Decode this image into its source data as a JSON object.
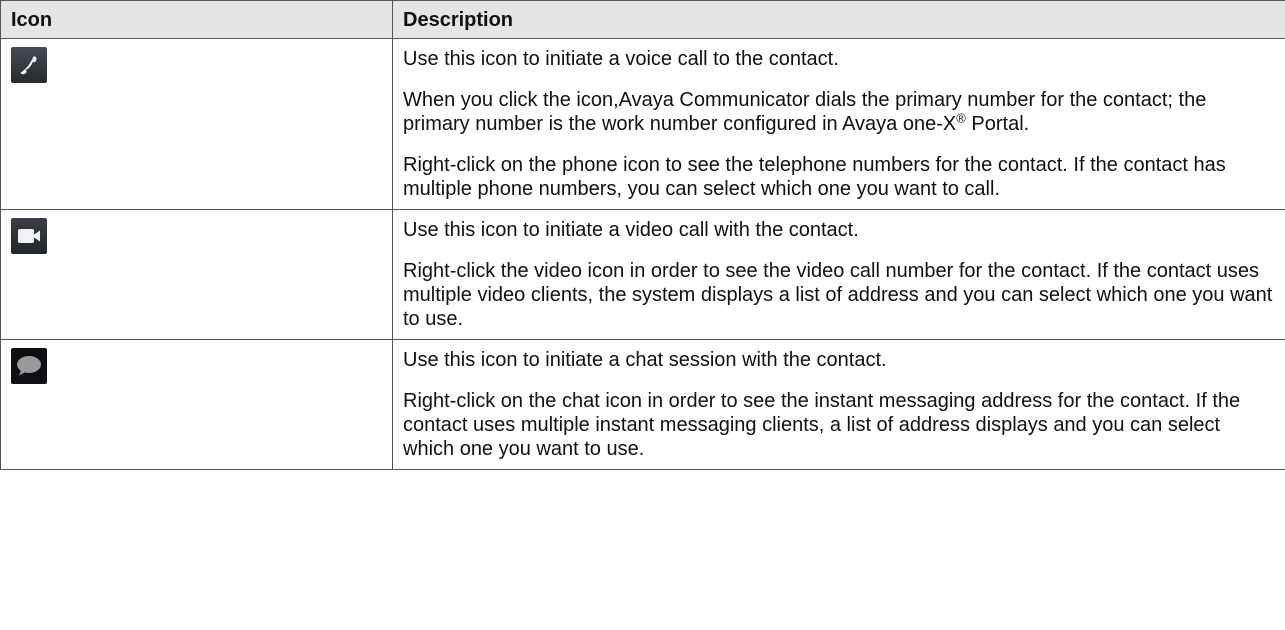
{
  "table": {
    "headers": {
      "icon": "Icon",
      "description": "Description"
    },
    "rows": [
      {
        "icon": "phone-icon",
        "paragraphs": [
          "Use this icon to initiate a voice call to the contact.",
          "When you click the icon,Avaya Communicator dials the primary number for the contact; the primary number is the work number configured in Avaya one-X",
          "Right-click on the phone icon to see the telephone numbers for the contact. If the contact has multiple phone numbers, you can select which one you want to call."
        ],
        "trademark": "®",
        "trademark_tail": " Portal."
      },
      {
        "icon": "video-camera-icon",
        "paragraphs": [
          "Use this icon to initiate a video call with the contact.",
          "Right-click the video icon in order to see the video call number for the contact. If the contact uses multiple video clients, the system displays a list of address and you can select which one you want to use."
        ]
      },
      {
        "icon": "chat-bubble-icon",
        "paragraphs": [
          "Use this icon to initiate a chat session with the contact.",
          "Right-click on the chat icon in order to see the instant messaging address for the contact. If the contact uses multiple instant messaging clients, a list of address displays and you can select which one you want to use."
        ]
      }
    ]
  }
}
